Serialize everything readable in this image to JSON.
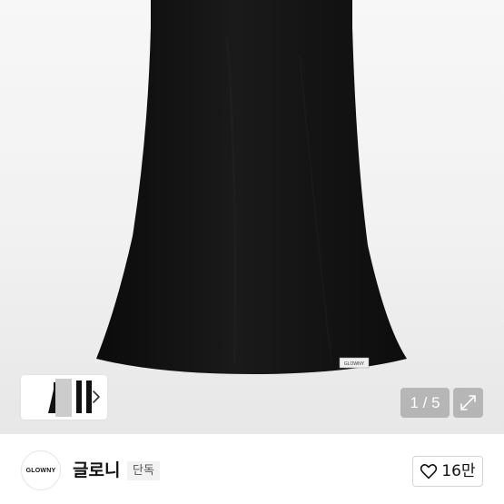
{
  "gallery": {
    "pager_text": "1 / 5",
    "current_page": 1,
    "total_pages": 5,
    "product_label_text": "GLOWNY"
  },
  "shop": {
    "logo_text": "GLOWNY",
    "brand_name": "글로니",
    "badge": "단독",
    "like_count": "16만"
  },
  "icons": {
    "thumbnail_next": "chevron-right-icon",
    "expand": "expand-icon",
    "like": "heart-outline-icon"
  },
  "colors": {
    "dress": "#121212",
    "background": "#f2f2f2",
    "pager_bg": "#8c8c8c"
  }
}
